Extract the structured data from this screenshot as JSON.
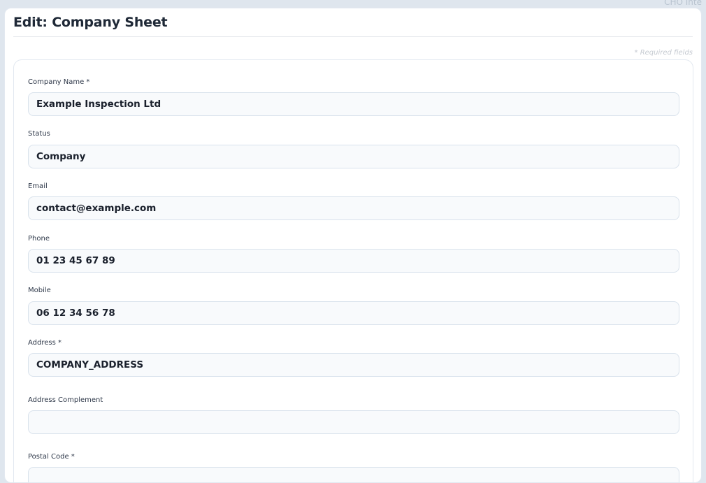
{
  "backdrop": {
    "hint_text": "CHO Inte"
  },
  "panel": {
    "title": "Edit: Company Sheet",
    "required_note": "* Required fields"
  },
  "form": {
    "company_name": {
      "label": "Company Name *",
      "value": "Example Inspection Ltd"
    },
    "status": {
      "label": "Status",
      "value": "Company"
    },
    "email": {
      "label": "Email",
      "value": "contact@example.com"
    },
    "phone": {
      "label": "Phone",
      "value": "01 23 45 67 89"
    },
    "mobile": {
      "label": "Mobile",
      "value": "06 12 34 56 78"
    },
    "address": {
      "label": "Address *",
      "value": "COMPANY_ADDRESS"
    },
    "address_complement": {
      "label": "Address Complement",
      "value": ""
    },
    "postal_code": {
      "label": "Postal Code *",
      "value": ""
    }
  },
  "colors": {
    "page_background": "#dfe6ee",
    "panel_background": "#ffffff",
    "input_background": "#f8fafc",
    "input_border": "#d9e2ec",
    "text_primary": "#1a202c",
    "required_note": "#c4c9d0"
  }
}
